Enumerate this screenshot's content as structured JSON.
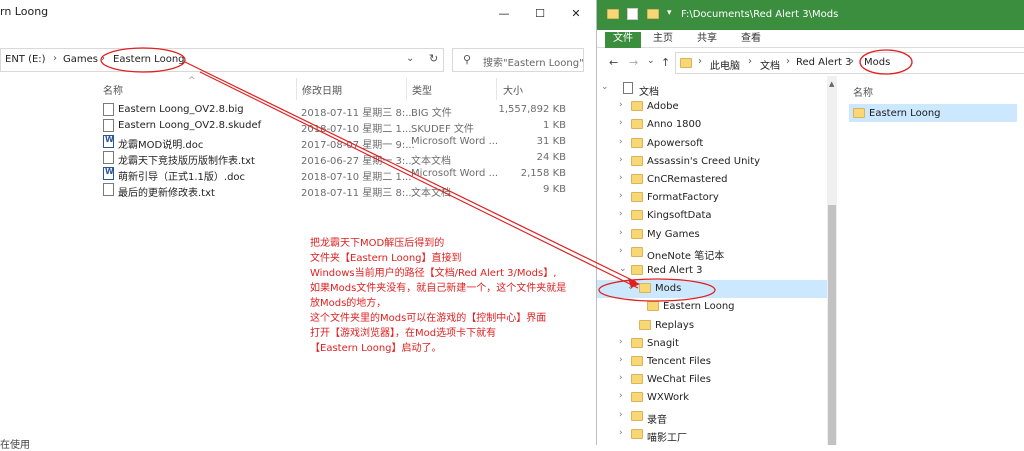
{
  "left": {
    "title": "rn Loong",
    "breadcrumb": [
      "ENT (E:)",
      "Games",
      "Eastern Loong"
    ],
    "search_placeholder": "搜索\"Eastern Loong\"",
    "columns": [
      "名称",
      "修改日期",
      "类型",
      "大小"
    ],
    "files": [
      {
        "name": "Eastern Loong_OV2.8.big",
        "date": "2018-07-11 星期三 8:...",
        "type": "BIG 文件",
        "size": "1,557,892 KB",
        "icon": "file-icon"
      },
      {
        "name": "Eastern Loong_OV2.8.skudef",
        "date": "2018-07-10 星期二 1...",
        "type": "SKUDEF 文件",
        "size": "1 KB",
        "icon": "file-icon"
      },
      {
        "name": "龙霸MOD说明.doc",
        "date": "2017-08-07 星期一 9:...",
        "type": "Microsoft Word ...",
        "size": "31 KB",
        "icon": "word-doc-icon"
      },
      {
        "name": "龙霸天下竞技版历版制作表.txt",
        "date": "2016-06-27 星期一 3:...",
        "type": "文本文档",
        "size": "24 KB",
        "icon": "file-icon"
      },
      {
        "name": "萌新引导（正式1.1版）.doc",
        "date": "2018-07-10 星期二 1...",
        "type": "Microsoft Word ...",
        "size": "2,158 KB",
        "icon": "word-doc-icon"
      },
      {
        "name": "最后的更新修改表.txt",
        "date": "2018-07-11 星期三 8:...",
        "type": "文本文档",
        "size": "9 KB",
        "icon": "file-icon"
      }
    ],
    "status": "在使用"
  },
  "right": {
    "title_path": "F:\\Documents\\Red Alert 3\\Mods",
    "ribbon_tabs": [
      "文件",
      "主页",
      "共享",
      "查看"
    ],
    "breadcrumb": [
      "此电脑",
      "文档",
      "Red Alert 3",
      "Mods"
    ],
    "tree": [
      {
        "label": "文档",
        "level": 0,
        "expanded": true
      },
      {
        "label": "Adobe",
        "level": 1
      },
      {
        "label": "Anno 1800",
        "level": 1
      },
      {
        "label": "Apowersoft",
        "level": 1
      },
      {
        "label": "Assassin's Creed Unity",
        "level": 1
      },
      {
        "label": "CnCRemastered",
        "level": 1
      },
      {
        "label": "FormatFactory",
        "level": 1
      },
      {
        "label": "KingsoftData",
        "level": 1
      },
      {
        "label": "My Games",
        "level": 1
      },
      {
        "label": "OneNote 笔记本",
        "level": 1
      },
      {
        "label": "Red Alert 3",
        "level": 1,
        "expanded": true
      },
      {
        "label": "Mods",
        "level": 2,
        "expanded": true,
        "selected": true
      },
      {
        "label": "Eastern Loong",
        "level": 3
      },
      {
        "label": "Replays",
        "level": 2
      },
      {
        "label": "Snagit",
        "level": 1
      },
      {
        "label": "Tencent Files",
        "level": 1
      },
      {
        "label": "WeChat Files",
        "level": 1
      },
      {
        "label": "WXWork",
        "level": 1
      },
      {
        "label": "录音",
        "level": 1
      },
      {
        "label": "喵影工厂",
        "level": 1
      }
    ],
    "content_column": "名称",
    "content_items": [
      "Eastern Loong"
    ]
  },
  "annotation": {
    "lines": [
      "把龙霸天下MOD解压后得到的",
      "文件夹【Eastern Loong】直接到",
      "Windows当前用户的路径【文档/Red Alert 3/Mods】,",
      "如果Mods文件夹没有，就自己新建一个，这个文件夹就是",
      "放Mods的地方，",
      "这个文件夹里的Mods可以在游戏的【控制中心】界面",
      "打开【游戏浏览器】，在Mod选项卡下就有",
      "【Eastern Loong】启动了。"
    ],
    "color": "#e02020"
  },
  "colors": {
    "accent_green": "#3a8e3d",
    "selection": "#cce8ff",
    "folder": "#f8d775"
  }
}
